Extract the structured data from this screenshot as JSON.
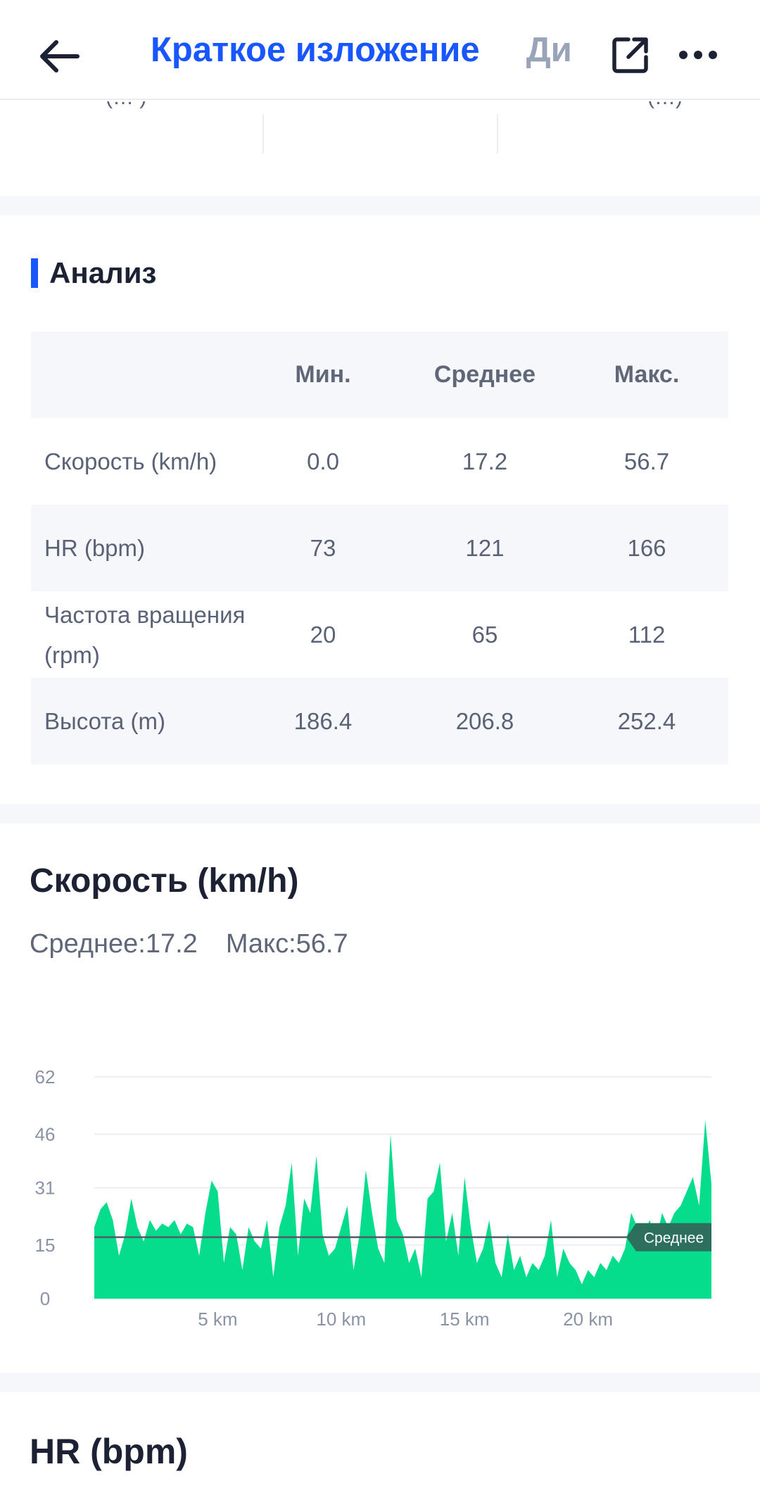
{
  "header": {
    "tabs": [
      {
        "label": "Краткое изложение",
        "active": true
      },
      {
        "label": "Диаграммы",
        "active": false
      }
    ],
    "icons": {
      "back": "arrow-left-icon",
      "share": "share-external-icon",
      "more": "more-dots-icon"
    },
    "accent_color": "#1856ff"
  },
  "summary_strip": {
    "cells": [
      "(… )",
      "",
      "(…)"
    ]
  },
  "analysis": {
    "title": "Анализ",
    "columns": [
      "",
      "Мин.",
      "Среднее",
      "Макс."
    ],
    "rows": [
      {
        "label": "Скорость (km/h)",
        "min": "0.0",
        "avg": "17.2",
        "max": "56.7"
      },
      {
        "label": "HR (bpm)",
        "min": "73",
        "avg": "121",
        "max": "166"
      },
      {
        "label": "Частота вращения (rpm)",
        "min": "20",
        "avg": "65",
        "max": "112"
      },
      {
        "label": "Высота (m)",
        "min": "186.4",
        "avg": "206.8",
        "max": "252.4"
      }
    ]
  },
  "speed_chart": {
    "title": "Скорость (km/h)",
    "avg_text": "Среднее:17.2",
    "max_text": "Макс:56.7",
    "average_badge": "Среднее"
  },
  "chart_data": {
    "type": "area",
    "title": "Скорость (km/h)",
    "xlabel": "",
    "ylabel": "",
    "x_ticks": [
      "5 km",
      "10 km",
      "15 km",
      "20 km"
    ],
    "x_tick_values": [
      5,
      10,
      15,
      20
    ],
    "y_ticks": [
      "0",
      "15",
      "31",
      "46",
      "62"
    ],
    "y_tick_values": [
      0,
      15,
      31,
      46,
      62
    ],
    "xlim": [
      0,
      25
    ],
    "ylim": [
      0,
      62
    ],
    "average": 17.2,
    "max": 56.7,
    "fill_color": "#05dd8c",
    "average_line_color": "#555b66",
    "grid": true,
    "series": [
      {
        "x": [
          0,
          0.25,
          0.5,
          0.75,
          1.0,
          1.25,
          1.5,
          1.75,
          2.0,
          2.25,
          2.5,
          2.75,
          3.0,
          3.25,
          3.5,
          3.75,
          4.0,
          4.25,
          4.5,
          4.75,
          5.0,
          5.25,
          5.5,
          5.75,
          6.0,
          6.25,
          6.5,
          6.75,
          7.0,
          7.25,
          7.5,
          7.75,
          8.0,
          8.25,
          8.5,
          8.75,
          9.0,
          9.25,
          9.5,
          9.75,
          10.0,
          10.25,
          10.5,
          10.75,
          11.0,
          11.25,
          11.5,
          11.75,
          12.0,
          12.25,
          12.5,
          12.75,
          13.0,
          13.25,
          13.5,
          13.75,
          14.0,
          14.25,
          14.5,
          14.75,
          15.0,
          15.25,
          15.5,
          15.75,
          16.0,
          16.25,
          16.5,
          16.75,
          17.0,
          17.25,
          17.5,
          17.75,
          18.0,
          18.25,
          18.5,
          18.75,
          19.0,
          19.25,
          19.5,
          19.75,
          20.0,
          20.25,
          20.5,
          20.75,
          21.0,
          21.25,
          21.5,
          21.75,
          22.0,
          22.25,
          22.5,
          22.75,
          23.0,
          23.25,
          23.5,
          23.75,
          24.0,
          24.25,
          24.5,
          24.75,
          25.0
        ],
        "y": [
          20,
          25,
          27,
          22,
          12,
          18,
          28,
          20,
          16,
          22,
          19,
          21,
          20,
          22,
          18,
          21,
          20,
          12,
          24,
          33,
          30,
          10,
          20,
          18,
          8,
          20,
          16,
          14,
          22,
          6,
          20,
          26,
          38,
          12,
          28,
          24,
          40,
          18,
          12,
          14,
          20,
          26,
          8,
          18,
          36,
          24,
          14,
          10,
          46,
          22,
          18,
          10,
          14,
          6,
          28,
          30,
          38,
          16,
          24,
          12,
          34,
          20,
          10,
          14,
          22,
          10,
          6,
          18,
          8,
          12,
          6,
          10,
          8,
          12,
          22,
          6,
          14,
          10,
          8,
          4,
          8,
          6,
          10,
          8,
          12,
          10,
          14,
          24,
          20,
          18,
          22,
          16,
          24,
          20,
          24,
          26,
          30,
          34,
          26,
          50,
          32
        ]
      }
    ]
  },
  "hr_chart": {
    "title": "HR (bpm)"
  }
}
